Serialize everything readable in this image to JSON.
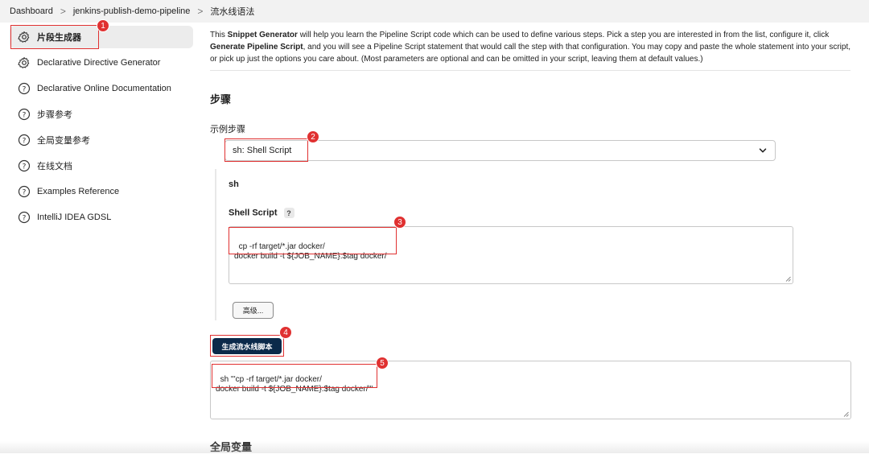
{
  "breadcrumb": {
    "items": [
      "Dashboard",
      "jenkins-publish-demo-pipeline",
      "流水线语法"
    ],
    "separator": ">"
  },
  "sidebar": {
    "items": [
      {
        "label": "片段生成器",
        "icon": "gear-icon",
        "active": true
      },
      {
        "label": "Declarative Directive Generator",
        "icon": "gear-icon",
        "active": false
      },
      {
        "label": "Declarative Online Documentation",
        "icon": "help-circle-icon",
        "active": false
      },
      {
        "label": "步骤参考",
        "icon": "help-circle-icon",
        "active": false
      },
      {
        "label": "全局变量参考",
        "icon": "help-circle-icon",
        "active": false
      },
      {
        "label": "在线文档",
        "icon": "help-circle-icon",
        "active": false
      },
      {
        "label": "Examples Reference",
        "icon": "help-circle-icon",
        "active": false
      },
      {
        "label": "IntelliJ IDEA GDSL",
        "icon": "help-circle-icon",
        "active": false
      }
    ]
  },
  "main": {
    "intro": {
      "p1": "This ",
      "b1": "Snippet Generator",
      "p2": " will help you learn the Pipeline Script code which can be used to define various steps. Pick a step you are interested in from the list, configure it, click ",
      "b2": "Generate Pipeline Script",
      "p3": ", and you will see a Pipeline Script statement that would call the step with that configuration. You may copy and paste the whole statement into your script, or pick up just the options you care about. (Most parameters are optional and can be omitted in your script, leaving them at default values.)"
    },
    "steps_title": "步骤",
    "sample_step_label": "示例步骤",
    "sample_step_value": "sh: Shell Script",
    "step_name": "sh",
    "shell_script_label": "Shell Script",
    "help_mark": "?",
    "shell_script_value": "cp -rf target/*.jar docker/\ndocker build -t ${JOB_NAME}:$tag docker/",
    "advanced_button": "高级...",
    "generate_button": "生成流水线脚本",
    "generated_output": "sh '''cp -rf target/*.jar docker/\ndocker build -t ${JOB_NAME}:$tag docker/'''",
    "global_vars_title": "全局变量"
  },
  "annotations": [
    "1",
    "2",
    "3",
    "4",
    "5"
  ],
  "colors": {
    "annotation": "#e03131",
    "primary_button": "#0b2a4a",
    "active_sidebar_bg": "#ececec"
  }
}
